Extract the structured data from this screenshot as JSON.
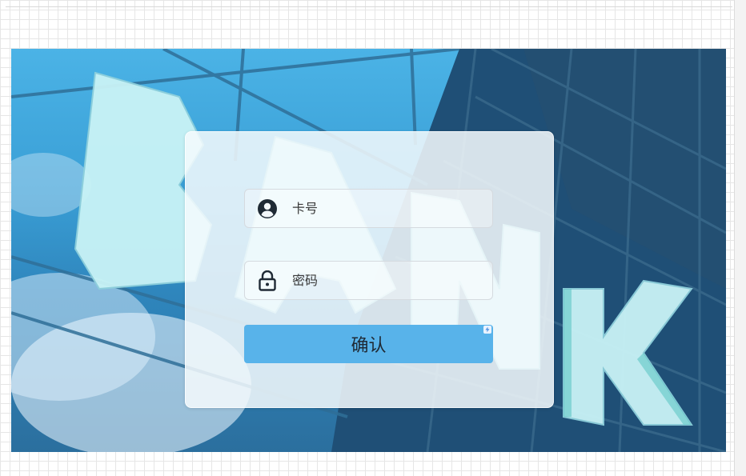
{
  "login": {
    "card_placeholder": "卡号",
    "password_placeholder": "密码",
    "confirm_label": "确认"
  },
  "icons": {
    "user": "user-circle-icon",
    "lock": "lock-icon",
    "badge": "lightning-icon"
  },
  "colors": {
    "button": "#58b3ea",
    "icon": "#1f2a35"
  }
}
